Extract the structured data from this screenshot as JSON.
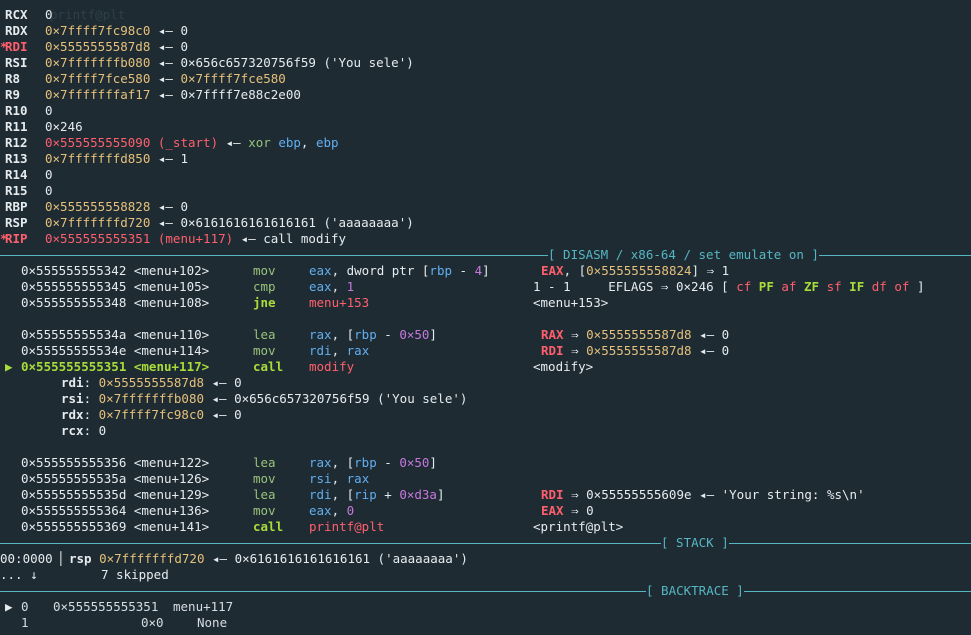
{
  "registers": [
    {
      "name": "RCX",
      "mark": "",
      "value": "0",
      "value_color": "w",
      "rest": []
    },
    {
      "name": "RDX",
      "mark": "",
      "value": "0×7ffff7fc98c0",
      "value_color": "yel",
      "rest": [
        {
          "t": " ◂— 0",
          "c": "w"
        }
      ]
    },
    {
      "name": "RDI",
      "mark": "*",
      "value": "0×5555555587d8",
      "value_color": "yel",
      "rest": [
        {
          "t": " ◂— 0",
          "c": "w"
        }
      ]
    },
    {
      "name": "RSI",
      "mark": "",
      "value": "0×7fffffffb080",
      "value_color": "yel",
      "rest": [
        {
          "t": " ◂— 0×656c657320756f59 ('You sele')",
          "c": "w"
        }
      ]
    },
    {
      "name": "R8",
      "mark": "",
      "value": "0×7ffff7fce580",
      "value_color": "yel",
      "rest": [
        {
          "t": " ◂— ",
          "c": "w"
        },
        {
          "t": "0×7ffff7fce580",
          "c": "yel"
        }
      ]
    },
    {
      "name": "R9",
      "mark": "",
      "value": "0×7fffffffaf17",
      "value_color": "yel",
      "rest": [
        {
          "t": " ◂— 0×7ffff7e88c2e00",
          "c": "w"
        }
      ]
    },
    {
      "name": "R10",
      "mark": "",
      "value": "0",
      "value_color": "w",
      "rest": []
    },
    {
      "name": "R11",
      "mark": "",
      "value": "0×246",
      "value_color": "w",
      "rest": []
    },
    {
      "name": "R12",
      "mark": "",
      "value": "0×555555555090 (_start)",
      "value_color": "red",
      "rest": [
        {
          "t": " ◂— ",
          "c": "w"
        },
        {
          "t": "xor",
          "c": "grn"
        },
        {
          "t": " ",
          "c": "w"
        },
        {
          "t": "ebp",
          "c": "blu"
        },
        {
          "t": ", ",
          "c": "w"
        },
        {
          "t": "ebp",
          "c": "blu"
        }
      ]
    },
    {
      "name": "R13",
      "mark": "",
      "value": "0×7fffffffd850",
      "value_color": "yel",
      "rest": [
        {
          "t": " ◂— 1",
          "c": "w"
        }
      ]
    },
    {
      "name": "R14",
      "mark": "",
      "value": "0",
      "value_color": "w",
      "rest": []
    },
    {
      "name": "R15",
      "mark": "",
      "value": "0",
      "value_color": "w",
      "rest": []
    },
    {
      "name": "RBP",
      "mark": "",
      "value": "0×555555558828",
      "value_color": "yel",
      "rest": [
        {
          "t": " ◂— 0",
          "c": "w"
        }
      ]
    },
    {
      "name": "RSP",
      "mark": "",
      "value": "0×7fffffffd720",
      "value_color": "yel",
      "rest": [
        {
          "t": " ◂— 0×6161616161616161 ('aaaaaaaa')",
          "c": "w"
        }
      ]
    },
    {
      "name": "RIP",
      "mark": "*",
      "value": "0×555555555351 (menu+117)",
      "value_color": "red",
      "rest": [
        {
          "t": " ◂— call modify",
          "c": "w"
        }
      ]
    }
  ],
  "top_faded": "printf@plt",
  "headers": {
    "disasm": "[ DISASM / x86-64 / set emulate on ]",
    "stack": "[ STACK ]",
    "backtrace": "[ BACKTRACE ]"
  },
  "disasm": [
    {
      "addr": "0×555555555342",
      "sym": "<menu+102>",
      "mn": "mov",
      "ops": [
        {
          "t": "eax",
          "c": "blu"
        },
        {
          "t": ", dword ptr [",
          "c": "w"
        },
        {
          "t": "rbp",
          "c": "blu"
        },
        {
          "t": " - ",
          "c": "w"
        },
        {
          "t": "4",
          "c": "pur"
        },
        {
          "t": "]",
          "c": "w"
        }
      ],
      "cm": [
        {
          "t": "EAX",
          "c": "redb"
        },
        {
          "t": ", [",
          "c": "w"
        },
        {
          "t": "0×555555558824",
          "c": "yel"
        },
        {
          "t": "] ⇒ 1",
          "c": "w"
        }
      ]
    },
    {
      "addr": "0×555555555345",
      "sym": "<menu+105>",
      "mn": "cmp",
      "ops": [
        {
          "t": "eax",
          "c": "blu"
        },
        {
          "t": ", ",
          "c": "w"
        },
        {
          "t": "1",
          "c": "pur"
        }
      ],
      "cm": [
        {
          "t": "1 - 1     EFLAGS ⇒ 0×246 [ ",
          "c": "w"
        },
        {
          "t": "cf",
          "c": "red"
        },
        {
          "t": " ",
          "c": "w"
        },
        {
          "t": "PF",
          "c": "grnb"
        },
        {
          "t": " ",
          "c": "w"
        },
        {
          "t": "af",
          "c": "red"
        },
        {
          "t": " ",
          "c": "w"
        },
        {
          "t": "ZF",
          "c": "grnb"
        },
        {
          "t": " ",
          "c": "w"
        },
        {
          "t": "sf",
          "c": "red"
        },
        {
          "t": " ",
          "c": "w"
        },
        {
          "t": "IF",
          "c": "grnb"
        },
        {
          "t": " ",
          "c": "w"
        },
        {
          "t": "df",
          "c": "red"
        },
        {
          "t": " ",
          "c": "w"
        },
        {
          "t": "of",
          "c": "red"
        },
        {
          "t": " ]",
          "c": "w"
        }
      ]
    },
    {
      "addr": "0×555555555348",
      "sym": "<menu+108>",
      "mn": "jne",
      "mnc": "grnb",
      "ops": [
        {
          "t": "menu+153",
          "c": "red"
        }
      ],
      "cm": [
        {
          "t": "<menu+153>",
          "c": "w"
        }
      ]
    },
    {
      "blank": true
    },
    {
      "addr": "0×55555555534a",
      "sym": "<menu+110>",
      "mn": "lea",
      "ops": [
        {
          "t": "rax",
          "c": "blu"
        },
        {
          "t": ", [",
          "c": "w"
        },
        {
          "t": "rbp",
          "c": "blu"
        },
        {
          "t": " - ",
          "c": "w"
        },
        {
          "t": "0×50",
          "c": "pur"
        },
        {
          "t": "]",
          "c": "w"
        }
      ],
      "cm": [
        {
          "t": "RAX",
          "c": "redb"
        },
        {
          "t": " ⇒ ",
          "c": "w"
        },
        {
          "t": "0×5555555587d8",
          "c": "yel"
        },
        {
          "t": " ◂— 0",
          "c": "w"
        }
      ]
    },
    {
      "addr": "0×55555555534e",
      "sym": "<menu+114>",
      "mn": "mov",
      "ops": [
        {
          "t": "rdi",
          "c": "blu"
        },
        {
          "t": ", ",
          "c": "w"
        },
        {
          "t": "rax",
          "c": "blu"
        }
      ],
      "cm": [
        {
          "t": "RDI",
          "c": "redb"
        },
        {
          "t": " ⇒ ",
          "c": "w"
        },
        {
          "t": "0×5555555587d8",
          "c": "yel"
        },
        {
          "t": " ◂— 0",
          "c": "w"
        }
      ]
    },
    {
      "current": true,
      "addr": "0×555555555351",
      "sym": "<menu+117>",
      "mn": "call",
      "mnc": "grnb",
      "ops": [
        {
          "t": "modify",
          "c": "red"
        }
      ],
      "cm": [
        {
          "t": "<modify>",
          "c": "w"
        }
      ]
    },
    {
      "arg": true,
      "name": "rdi",
      "parts": [
        {
          "t": "0×5555555587d8",
          "c": "yel"
        },
        {
          "t": " ◂— 0",
          "c": "w"
        }
      ]
    },
    {
      "arg": true,
      "name": "rsi",
      "parts": [
        {
          "t": "0×7fffffffb080",
          "c": "yel"
        },
        {
          "t": " ◂— 0×656c657320756f59 ('You sele')",
          "c": "w"
        }
      ]
    },
    {
      "arg": true,
      "name": "rdx",
      "parts": [
        {
          "t": "0×7ffff7fc98c0",
          "c": "yel"
        },
        {
          "t": " ◂— 0",
          "c": "w"
        }
      ]
    },
    {
      "arg": true,
      "name": "rcx",
      "parts": [
        {
          "t": "0",
          "c": "w"
        }
      ]
    },
    {
      "blank": true
    },
    {
      "addr": "0×555555555356",
      "sym": "<menu+122>",
      "mn": "lea",
      "ops": [
        {
          "t": "rax",
          "c": "blu"
        },
        {
          "t": ", [",
          "c": "w"
        },
        {
          "t": "rbp",
          "c": "blu"
        },
        {
          "t": " - ",
          "c": "w"
        },
        {
          "t": "0×50",
          "c": "pur"
        },
        {
          "t": "]",
          "c": "w"
        }
      ],
      "cm": []
    },
    {
      "addr": "0×55555555535a",
      "sym": "<menu+126>",
      "mn": "mov",
      "ops": [
        {
          "t": "rsi",
          "c": "blu"
        },
        {
          "t": ", ",
          "c": "w"
        },
        {
          "t": "rax",
          "c": "blu"
        }
      ],
      "cm": []
    },
    {
      "addr": "0×55555555535d",
      "sym": "<menu+129>",
      "mn": "lea",
      "ops": [
        {
          "t": "rdi",
          "c": "blu"
        },
        {
          "t": ", [",
          "c": "w"
        },
        {
          "t": "rip",
          "c": "blu"
        },
        {
          "t": " + ",
          "c": "w"
        },
        {
          "t": "0×d3a",
          "c": "pur"
        },
        {
          "t": "]",
          "c": "w"
        }
      ],
      "cm": [
        {
          "t": "RDI",
          "c": "redb"
        },
        {
          "t": " ⇒ 0×55555555609e ◂— 'Your string: %s\\n'",
          "c": "w"
        }
      ]
    },
    {
      "addr": "0×555555555364",
      "sym": "<menu+136>",
      "mn": "mov",
      "ops": [
        {
          "t": "eax",
          "c": "blu"
        },
        {
          "t": ", ",
          "c": "w"
        },
        {
          "t": "0",
          "c": "pur"
        }
      ],
      "cm": [
        {
          "t": "EAX",
          "c": "redb"
        },
        {
          "t": " ⇒ 0",
          "c": "w"
        }
      ]
    },
    {
      "addr": "0×555555555369",
      "sym": "<menu+141>",
      "mn": "call",
      "mnc": "grnb",
      "ops": [
        {
          "t": "printf@plt",
          "c": "red"
        }
      ],
      "cm": [
        {
          "t": "<printf@plt>",
          "c": "w"
        }
      ]
    }
  ],
  "stack": {
    "index": "00:0000",
    "reg": "rsp",
    "addr": "0×7fffffffd720",
    "rest": " ◂— 0×6161616161616161 ('aaaaaaaa')",
    "skip_prefix": "... ↓",
    "skipped": "7 skipped"
  },
  "backtrace": [
    {
      "marker": "▶",
      "idx": "0",
      "addr": "0×555555555351",
      "fn": "menu+117"
    },
    {
      "marker": "",
      "idx": "1",
      "addr": "0×0",
      "fn": "None"
    }
  ]
}
